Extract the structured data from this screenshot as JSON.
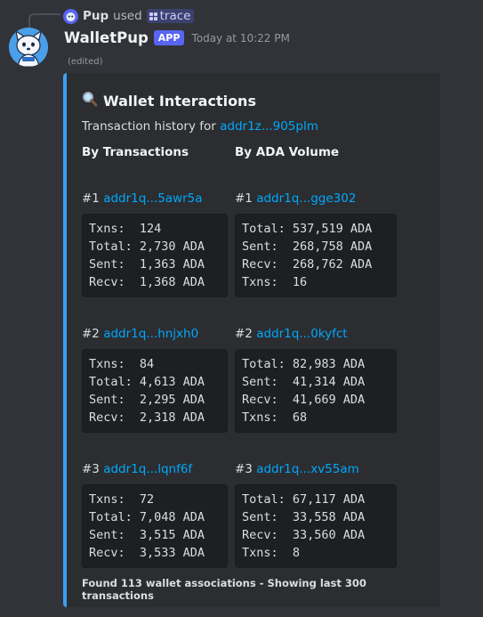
{
  "reply": {
    "name": "Pup",
    "used": "used",
    "command": "trace"
  },
  "header": {
    "username": "WalletPup",
    "tag": "APP",
    "timestamp": "Today at 10:22 PM",
    "edited": "(edited)"
  },
  "embed": {
    "accent_color": "#3a9ff5",
    "title_icon": "magnifier-icon",
    "title": "Wallet Interactions",
    "description_prefix": "Transaction history for",
    "description_address": "addr1z...905plm",
    "col_left_header": "By Transactions",
    "col_right_header": "By ADA Volume",
    "by_transactions": [
      {
        "rank": "#1",
        "address": "addr1q...5awr5a",
        "lines": "Txns:  124\nTotal: 2,730 ADA\nSent:  1,363 ADA\nRecv:  1,368 ADA"
      },
      {
        "rank": "#2",
        "address": "addr1q...hnjxh0",
        "lines": "Txns:  84\nTotal: 4,613 ADA\nSent:  2,295 ADA\nRecv:  2,318 ADA"
      },
      {
        "rank": "#3",
        "address": "addr1q...lqnf6f",
        "lines": "Txns:  72\nTotal: 7,048 ADA\nSent:  3,515 ADA\nRecv:  3,533 ADA"
      }
    ],
    "by_volume": [
      {
        "rank": "#1",
        "address": "addr1q...gge302",
        "lines": "Total: 537,519 ADA\nSent:  268,758 ADA\nRecv:  268,762 ADA\nTxns:  16"
      },
      {
        "rank": "#2",
        "address": "addr1q...0kyfct",
        "lines": "Total: 82,983 ADA\nSent:  41,314 ADA\nRecv:  41,669 ADA\nTxns:  68"
      },
      {
        "rank": "#3",
        "address": "addr1q...xv55am",
        "lines": "Total: 67,117 ADA\nSent:  33,558 ADA\nRecv:  33,560 ADA\nTxns:  8"
      }
    ],
    "footer": "Found 113 wallet associations - Showing last 300 transactions"
  }
}
